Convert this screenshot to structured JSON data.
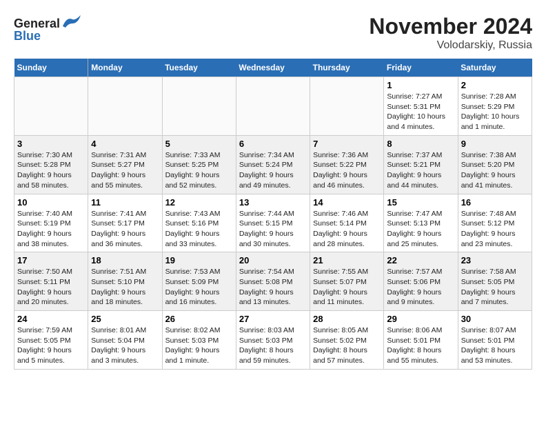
{
  "header": {
    "logo_general": "General",
    "logo_blue": "Blue",
    "month_title": "November 2024",
    "subtitle": "Volodarskiy, Russia"
  },
  "weekdays": [
    "Sunday",
    "Monday",
    "Tuesday",
    "Wednesday",
    "Thursday",
    "Friday",
    "Saturday"
  ],
  "weeks": [
    [
      {
        "day": "",
        "info": ""
      },
      {
        "day": "",
        "info": ""
      },
      {
        "day": "",
        "info": ""
      },
      {
        "day": "",
        "info": ""
      },
      {
        "day": "",
        "info": ""
      },
      {
        "day": "1",
        "info": "Sunrise: 7:27 AM\nSunset: 5:31 PM\nDaylight: 10 hours\nand 4 minutes."
      },
      {
        "day": "2",
        "info": "Sunrise: 7:28 AM\nSunset: 5:29 PM\nDaylight: 10 hours\nand 1 minute."
      }
    ],
    [
      {
        "day": "3",
        "info": "Sunrise: 7:30 AM\nSunset: 5:28 PM\nDaylight: 9 hours\nand 58 minutes."
      },
      {
        "day": "4",
        "info": "Sunrise: 7:31 AM\nSunset: 5:27 PM\nDaylight: 9 hours\nand 55 minutes."
      },
      {
        "day": "5",
        "info": "Sunrise: 7:33 AM\nSunset: 5:25 PM\nDaylight: 9 hours\nand 52 minutes."
      },
      {
        "day": "6",
        "info": "Sunrise: 7:34 AM\nSunset: 5:24 PM\nDaylight: 9 hours\nand 49 minutes."
      },
      {
        "day": "7",
        "info": "Sunrise: 7:36 AM\nSunset: 5:22 PM\nDaylight: 9 hours\nand 46 minutes."
      },
      {
        "day": "8",
        "info": "Sunrise: 7:37 AM\nSunset: 5:21 PM\nDaylight: 9 hours\nand 44 minutes."
      },
      {
        "day": "9",
        "info": "Sunrise: 7:38 AM\nSunset: 5:20 PM\nDaylight: 9 hours\nand 41 minutes."
      }
    ],
    [
      {
        "day": "10",
        "info": "Sunrise: 7:40 AM\nSunset: 5:19 PM\nDaylight: 9 hours\nand 38 minutes."
      },
      {
        "day": "11",
        "info": "Sunrise: 7:41 AM\nSunset: 5:17 PM\nDaylight: 9 hours\nand 36 minutes."
      },
      {
        "day": "12",
        "info": "Sunrise: 7:43 AM\nSunset: 5:16 PM\nDaylight: 9 hours\nand 33 minutes."
      },
      {
        "day": "13",
        "info": "Sunrise: 7:44 AM\nSunset: 5:15 PM\nDaylight: 9 hours\nand 30 minutes."
      },
      {
        "day": "14",
        "info": "Sunrise: 7:46 AM\nSunset: 5:14 PM\nDaylight: 9 hours\nand 28 minutes."
      },
      {
        "day": "15",
        "info": "Sunrise: 7:47 AM\nSunset: 5:13 PM\nDaylight: 9 hours\nand 25 minutes."
      },
      {
        "day": "16",
        "info": "Sunrise: 7:48 AM\nSunset: 5:12 PM\nDaylight: 9 hours\nand 23 minutes."
      }
    ],
    [
      {
        "day": "17",
        "info": "Sunrise: 7:50 AM\nSunset: 5:11 PM\nDaylight: 9 hours\nand 20 minutes."
      },
      {
        "day": "18",
        "info": "Sunrise: 7:51 AM\nSunset: 5:10 PM\nDaylight: 9 hours\nand 18 minutes."
      },
      {
        "day": "19",
        "info": "Sunrise: 7:53 AM\nSunset: 5:09 PM\nDaylight: 9 hours\nand 16 minutes."
      },
      {
        "day": "20",
        "info": "Sunrise: 7:54 AM\nSunset: 5:08 PM\nDaylight: 9 hours\nand 13 minutes."
      },
      {
        "day": "21",
        "info": "Sunrise: 7:55 AM\nSunset: 5:07 PM\nDaylight: 9 hours\nand 11 minutes."
      },
      {
        "day": "22",
        "info": "Sunrise: 7:57 AM\nSunset: 5:06 PM\nDaylight: 9 hours\nand 9 minutes."
      },
      {
        "day": "23",
        "info": "Sunrise: 7:58 AM\nSunset: 5:05 PM\nDaylight: 9 hours\nand 7 minutes."
      }
    ],
    [
      {
        "day": "24",
        "info": "Sunrise: 7:59 AM\nSunset: 5:05 PM\nDaylight: 9 hours\nand 5 minutes."
      },
      {
        "day": "25",
        "info": "Sunrise: 8:01 AM\nSunset: 5:04 PM\nDaylight: 9 hours\nand 3 minutes."
      },
      {
        "day": "26",
        "info": "Sunrise: 8:02 AM\nSunset: 5:03 PM\nDaylight: 9 hours\nand 1 minute."
      },
      {
        "day": "27",
        "info": "Sunrise: 8:03 AM\nSunset: 5:03 PM\nDaylight: 8 hours\nand 59 minutes."
      },
      {
        "day": "28",
        "info": "Sunrise: 8:05 AM\nSunset: 5:02 PM\nDaylight: 8 hours\nand 57 minutes."
      },
      {
        "day": "29",
        "info": "Sunrise: 8:06 AM\nSunset: 5:01 PM\nDaylight: 8 hours\nand 55 minutes."
      },
      {
        "day": "30",
        "info": "Sunrise: 8:07 AM\nSunset: 5:01 PM\nDaylight: 8 hours\nand 53 minutes."
      }
    ]
  ]
}
